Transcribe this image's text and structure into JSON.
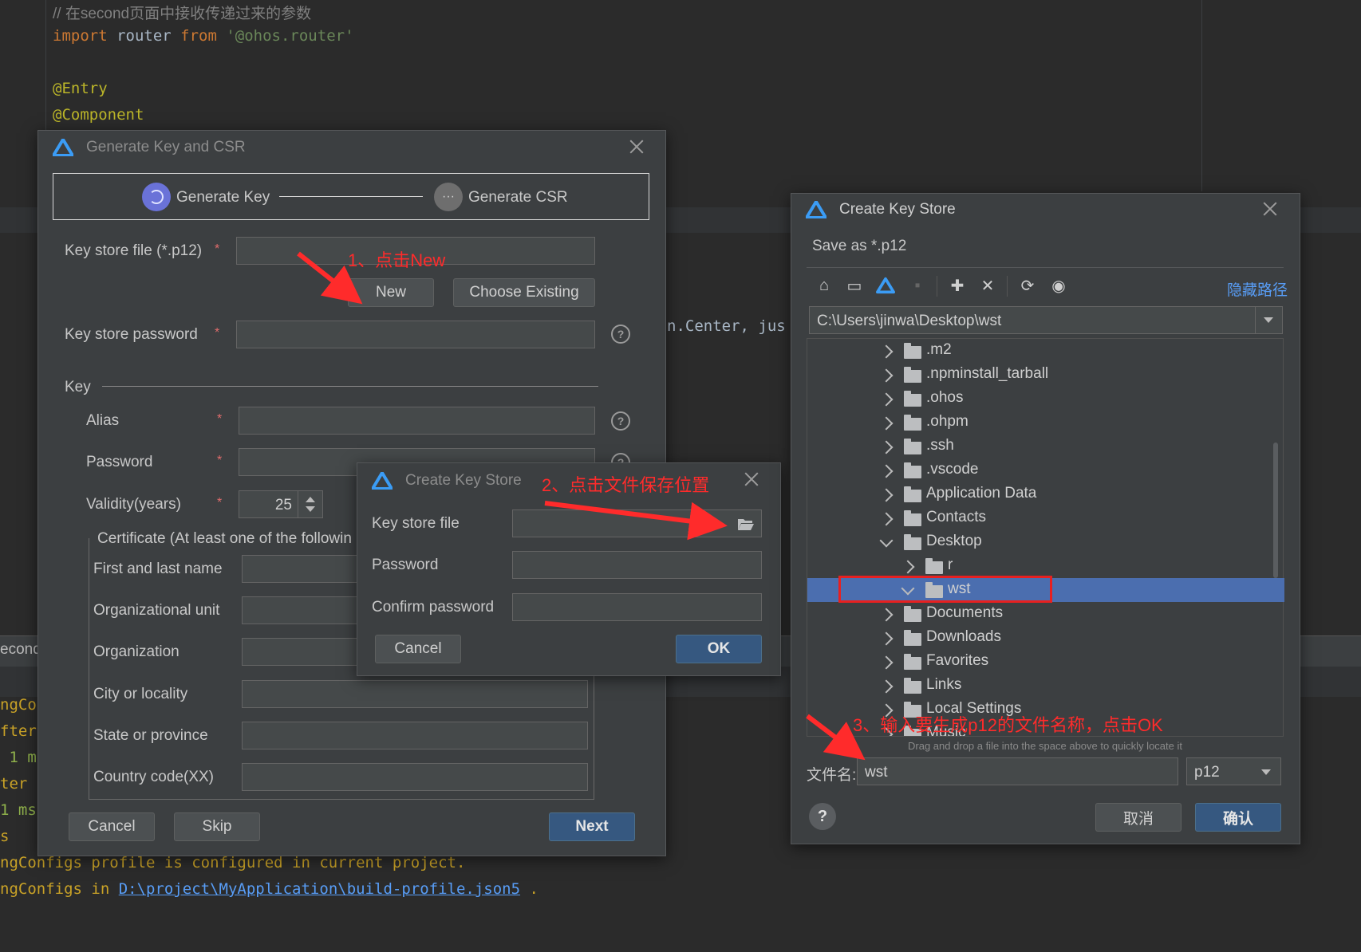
{
  "editor": {
    "comment": "// 在second页面中接收传递过来的参数",
    "import_kw": "import",
    "import_name": " router ",
    "from_kw": "from",
    "import_path": " '@ohos.router'",
    "entry": "@Entry",
    "component": "@Component",
    "partial_code": "n.Center, jus"
  },
  "console": {
    "tab_partial": "econd",
    "lines": [
      "ngCo",
      "fter",
      " 1 m",
      "ter ",
      "1 ms",
      "s"
    ],
    "line1": "ngConfigs profile is configured in current project.",
    "line2_prefix": "ngConfigs in ",
    "line2_link": "D:\\project\\MyApplication\\build-profile.json5",
    "line2_suffix": " ."
  },
  "generate_dialog": {
    "title": "Generate Key and CSR",
    "step1": "Generate Key",
    "step2": "Generate CSR",
    "keystore_file_label": "Key store file (*.p12)",
    "new_button": "New",
    "choose_existing_button": "Choose Existing",
    "keystore_password_label": "Key store password",
    "key_section": "Key",
    "alias_label": "Alias",
    "password_label": "Password",
    "validity_label": "Validity(years)",
    "validity_value": "25",
    "certificate_label": "Certificate (At least one of the followin",
    "first_last_name": "First and last name",
    "org_unit": "Organizational unit",
    "organization": "Organization",
    "city": "City or locality",
    "state": "State or province",
    "country": "Country code(XX)",
    "cancel": "Cancel",
    "skip": "Skip",
    "next": "Next",
    "required_mark": "*"
  },
  "small_keystore_dialog": {
    "title": "Create Key Store",
    "key_store_file_label": "Key store file",
    "password_label": "Password",
    "confirm_password_label": "Confirm password",
    "cancel": "Cancel",
    "ok": "OK"
  },
  "file_chooser": {
    "title": "Create Key Store",
    "subtitle": "Save as *.p12",
    "hide_path": "隐藏路径",
    "path": "C:\\Users\\jinwa\\Desktop\\wst",
    "tree": [
      {
        "name": ".m2",
        "expanded": false,
        "indent": 0,
        "selected": false
      },
      {
        "name": ".npminstall_tarball",
        "expanded": false,
        "indent": 0,
        "selected": false
      },
      {
        "name": ".ohos",
        "expanded": false,
        "indent": 0,
        "selected": false
      },
      {
        "name": ".ohpm",
        "expanded": false,
        "indent": 0,
        "selected": false
      },
      {
        "name": ".ssh",
        "expanded": false,
        "indent": 0,
        "selected": false
      },
      {
        "name": ".vscode",
        "expanded": false,
        "indent": 0,
        "selected": false
      },
      {
        "name": "Application Data",
        "expanded": false,
        "indent": 0,
        "selected": false
      },
      {
        "name": "Contacts",
        "expanded": false,
        "indent": 0,
        "selected": false
      },
      {
        "name": "Desktop",
        "expanded": true,
        "indent": 0,
        "selected": false
      },
      {
        "name": "r",
        "expanded": false,
        "indent": 1,
        "selected": false
      },
      {
        "name": "wst",
        "expanded": true,
        "indent": 1,
        "selected": true
      },
      {
        "name": "Documents",
        "expanded": false,
        "indent": 0,
        "selected": false
      },
      {
        "name": "Downloads",
        "expanded": false,
        "indent": 0,
        "selected": false
      },
      {
        "name": "Favorites",
        "expanded": false,
        "indent": 0,
        "selected": false
      },
      {
        "name": "Links",
        "expanded": false,
        "indent": 0,
        "selected": false
      },
      {
        "name": "Local Settings",
        "expanded": false,
        "indent": 0,
        "selected": false
      },
      {
        "name": "Music",
        "expanded": false,
        "indent": 0,
        "selected": false
      }
    ],
    "drag_hint": "Drag and drop a file into the space above to quickly locate it",
    "filename_label": "文件名:",
    "filename_value": "wst",
    "filetype": "p12",
    "cancel": "取消",
    "confirm": "确认",
    "help": "?"
  },
  "annotations": {
    "step1": "1、点击New",
    "step2": "2、点击文件保存位置",
    "step3": "3、输入要生成p12的文件名称，点击OK"
  },
  "colors": {
    "selection": "#4b6eaf",
    "annotation_red": "#ff2b2b",
    "primary_button": "#365880"
  }
}
